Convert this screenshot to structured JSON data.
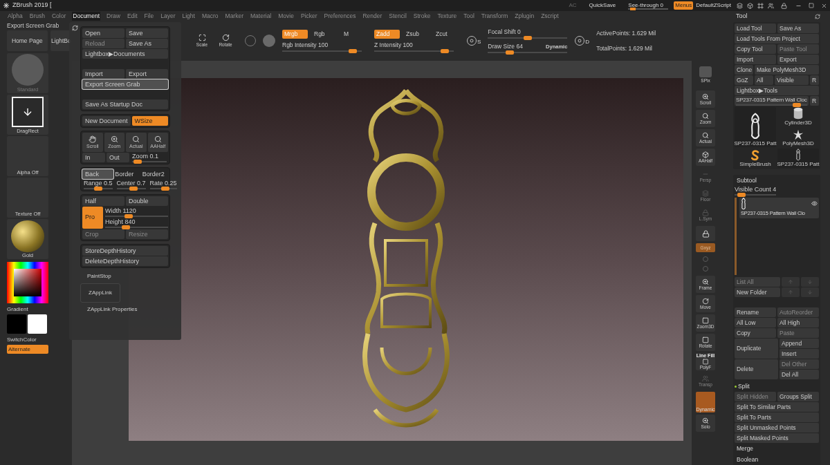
{
  "title_bar": {
    "title": "ZBrush 2019 [",
    "ac": "AC",
    "quicksave": "QuickSave",
    "see_through": {
      "label": "See-through",
      "value": "0",
      "level": 0.05
    },
    "menus": {
      "label": "Menus",
      "on": true
    },
    "script": "DefaultZScript"
  },
  "menu_bar": [
    {
      "label": "Alpha",
      "selected": false
    },
    {
      "label": "Brush",
      "selected": false
    },
    {
      "label": "Color",
      "selected": false
    },
    {
      "label": "Document",
      "selected": true
    },
    {
      "label": "Draw",
      "selected": false
    },
    {
      "label": "Edit",
      "selected": false
    },
    {
      "label": "File",
      "selected": false
    },
    {
      "label": "Layer",
      "selected": false
    },
    {
      "label": "Light",
      "selected": false
    },
    {
      "label": "Macro",
      "selected": false
    },
    {
      "label": "Marker",
      "selected": false
    },
    {
      "label": "Material",
      "selected": false
    },
    {
      "label": "Movie",
      "selected": false
    },
    {
      "label": "Picker",
      "selected": false
    },
    {
      "label": "Preferences",
      "selected": false
    },
    {
      "label": "Render",
      "selected": false
    },
    {
      "label": "Stencil",
      "selected": false
    },
    {
      "label": "Stroke",
      "selected": false
    },
    {
      "label": "Texture",
      "selected": false
    },
    {
      "label": "Tool",
      "selected": false
    },
    {
      "label": "Transform",
      "selected": false
    },
    {
      "label": "Zplugin",
      "selected": false
    },
    {
      "label": "Zscript",
      "selected": false
    }
  ],
  "left_shelf": {
    "hint": "Export Screen Grab",
    "buttons": [
      {
        "label": "Home Page"
      },
      {
        "label": "LightBo"
      }
    ],
    "slots": [
      {
        "kind": "brush",
        "label": "Standard"
      },
      {
        "kind": "stroke",
        "label": "DragRect"
      },
      {
        "kind": "empty",
        "label": "Alpha Off"
      },
      {
        "kind": "empty",
        "label": "Texture Off"
      },
      {
        "kind": "material",
        "label": "Gold"
      }
    ],
    "gradient": "Gradient",
    "switch_color": "SwitchColor",
    "alternate": {
      "label": "Alternate",
      "on": true
    }
  },
  "toolbar": {
    "transform": [
      {
        "label": "Scale"
      },
      {
        "label": "Rotate"
      }
    ],
    "rgb": {
      "modes": [
        {
          "label": "Mrgb",
          "on": true
        },
        {
          "label": "Rgb",
          "on": false
        },
        {
          "label": "M",
          "on": false
        }
      ],
      "slider": {
        "label": "Rgb Intensity",
        "value": "100",
        "level": 0.93
      }
    },
    "z": {
      "modes": [
        {
          "label": "Zadd",
          "on": true
        },
        {
          "label": "Zsub",
          "on": false
        },
        {
          "label": "Zcut",
          "on": false
        }
      ],
      "slider": {
        "label": "Z Intensity",
        "value": "100",
        "level": 0.93
      }
    },
    "s_label": "S",
    "focal": {
      "label": "Focal Shift",
      "value": "0",
      "level": 0.5
    },
    "draw_size": {
      "label": "Draw Size",
      "value": "64",
      "level": 0.25
    },
    "dynamic": "Dynamic",
    "d_label": "D",
    "points": [
      "ActivePoints: 1.629 Mil",
      "TotalPoints: 1.629 Mil"
    ]
  },
  "document_menu": {
    "panels": [
      {
        "sections": [
          [
            {
              "kind": "row",
              "items": [
                {
                  "kind": "button",
                  "label": "Open",
                  "disabled": false
                },
                {
                  "kind": "button",
                  "label": "Save",
                  "disabled": false
                }
              ]
            },
            {
              "kind": "row",
              "items": [
                {
                  "kind": "button",
                  "label": "Reload",
                  "disabled": true
                },
                {
                  "kind": "button",
                  "label": "Save As",
                  "disabled": false
                }
              ]
            },
            {
              "kind": "row",
              "items": [
                {
                  "kind": "button",
                  "label": "Lightbox▶Documents",
                  "disabled": false
                }
              ]
            }
          ],
          [
            {
              "kind": "row",
              "items": [
                {
                  "kind": "button",
                  "label": "Import",
                  "disabled": false
                },
                {
                  "kind": "button",
                  "label": "Export",
                  "disabled": false
                }
              ]
            },
            {
              "kind": "row",
              "items": [
                {
                  "kind": "button",
                  "label": "Export Screen Grab",
                  "disabled": false,
                  "highlighted": true
                }
              ]
            }
          ],
          [
            {
              "kind": "row",
              "items": [
                {
                  "kind": "button",
                  "label": "Save As Startup Doc",
                  "disabled": false
                }
              ]
            }
          ]
        ]
      },
      {
        "sections": [
          [
            {
              "kind": "row",
              "items": [
                {
                  "kind": "button",
                  "label": "New Document",
                  "disabled": false
                },
                {
                  "kind": "toggle",
                  "label": "WSize",
                  "on": true
                }
              ]
            }
          ]
        ]
      },
      {
        "sections": [
          [
            {
              "kind": "icons",
              "items": [
                {
                  "kind": "icon_button",
                  "label": "Scroll"
                },
                {
                  "kind": "icon_button",
                  "label": "Zoom"
                },
                {
                  "kind": "icon_button",
                  "label": "Actual"
                },
                {
                  "kind": "icon_button",
                  "label": "AAHalf"
                }
              ]
            },
            {
              "kind": "row",
              "items": [
                {
                  "kind": "button",
                  "label": "In",
                  "disabled": false
                },
                {
                  "kind": "button",
                  "label": "Out",
                  "disabled": false
                },
                {
                  "kind": "slider",
                  "label": "Zoom",
                  "value": "0.1",
                  "level": 0.05
                }
              ]
            }
          ]
        ]
      },
      {
        "sections": [
          [
            {
              "kind": "row",
              "items": [
                {
                  "kind": "button",
                  "label": "Back",
                  "disabled": false,
                  "highlighted": true
                },
                {
                  "kind": "label",
                  "label": "Border"
                },
                {
                  "kind": "label",
                  "label": "Border2"
                }
              ]
            },
            {
              "kind": "row",
              "items": [
                {
                  "kind": "slider",
                  "label": "Range",
                  "value": "0.5",
                  "level": 0.5
                },
                {
                  "kind": "slider",
                  "label": "Center",
                  "value": "0.7",
                  "level": 0.6
                },
                {
                  "kind": "slider",
                  "label": "Rate",
                  "value": "0.25",
                  "level": 0.6
                }
              ]
            }
          ]
        ]
      },
      {
        "sections": [
          [
            {
              "kind": "row",
              "items": [
                {
                  "kind": "button",
                  "label": "Half",
                  "disabled": false
                },
                {
                  "kind": "button",
                  "label": "Double",
                  "disabled": false
                }
              ]
            },
            {
              "kind": "stack",
              "items": [
                {
                  "kind": "toggle",
                  "label": "Pro",
                  "on": true
                },
                {
                  "kind": "slider",
                  "label": "Width",
                  "value": "1120",
                  "level": 0.35
                },
                {
                  "kind": "slider",
                  "label": "Height",
                  "value": "840",
                  "level": 0.3
                }
              ]
            },
            {
              "kind": "row",
              "items": [
                {
                  "kind": "button",
                  "label": "Crop",
                  "disabled": true
                },
                {
                  "kind": "button",
                  "label": "Resize",
                  "disabled": true
                }
              ]
            }
          ]
        ]
      },
      {
        "sections": [
          [
            {
              "kind": "row",
              "items": [
                {
                  "kind": "button",
                  "label": "StoreDepthHistory",
                  "disabled": false
                }
              ]
            },
            {
              "kind": "row",
              "items": [
                {
                  "kind": "button",
                  "label": "DeleteDepthHistory",
                  "disabled": false
                }
              ]
            }
          ]
        ]
      }
    ],
    "paint_stop": "PaintStop",
    "zapplink": "ZAppLink",
    "zapplink_properties": "ZAppLink Properties"
  },
  "right_shelf": [
    {
      "kind": "spix",
      "label": "SPix",
      "disabled": false
    },
    {
      "kind": "icon",
      "label": "Scroll",
      "disabled": false
    },
    {
      "kind": "icon",
      "label": "Zoom",
      "disabled": false
    },
    {
      "kind": "icon",
      "label": "Actual",
      "disabled": false
    },
    {
      "kind": "icon",
      "label": "AAHalf",
      "disabled": false
    },
    {
      "kind": "icon",
      "label": "Persp",
      "disabled": true
    },
    {
      "kind": "icon",
      "label": "Floor",
      "disabled": true
    },
    {
      "kind": "icon",
      "label": "L.Sym",
      "disabled": true
    },
    {
      "kind": "lock",
      "disabled": false
    },
    {
      "kind": "toggle",
      "label": "Gxyz",
      "on": true
    },
    {
      "kind": "axes",
      "disabled": true
    },
    {
      "kind": "icon",
      "label": "Frame",
      "disabled": false
    },
    {
      "kind": "icon",
      "label": "Move",
      "disabled": false
    },
    {
      "kind": "icon",
      "label": "Zoom3D",
      "disabled": false
    },
    {
      "kind": "icon",
      "label": "Rotate",
      "disabled": false
    },
    {
      "kind": "polyf",
      "top": "Line Fill",
      "label": "PolyF",
      "disabled": false
    },
    {
      "kind": "icon",
      "label": "Transp",
      "disabled": true
    },
    {
      "kind": "dynamic",
      "label": "Dynamic",
      "on": true
    },
    {
      "kind": "icon",
      "label": "Solo",
      "disabled": false
    }
  ],
  "tool_panel": {
    "title": "Tool",
    "rows": [
      [
        {
          "kind": "button",
          "label": "Load Tool",
          "disabled": false
        },
        {
          "kind": "button",
          "label": "Save As",
          "disabled": false
        }
      ],
      [
        {
          "kind": "button",
          "label": "Load Tools From Project",
          "disabled": false
        }
      ],
      [
        {
          "kind": "button",
          "label": "Copy Tool",
          "disabled": false
        },
        {
          "kind": "button",
          "label": "Paste Tool",
          "disabled": true
        }
      ],
      [
        {
          "kind": "button",
          "label": "Import",
          "disabled": false
        },
        {
          "kind": "button",
          "label": "Export",
          "disabled": false
        }
      ],
      [
        {
          "kind": "small",
          "label": "Clone",
          "disabled": false
        },
        {
          "kind": "button",
          "label": "Make PolyMesh3D",
          "disabled": false
        }
      ],
      [
        {
          "kind": "small",
          "label": "GoZ",
          "disabled": false
        },
        {
          "kind": "small",
          "label": "All",
          "disabled": false
        },
        {
          "kind": "button",
          "label": "Visible",
          "disabled": false
        },
        {
          "kind": "tiny",
          "label": "R",
          "disabled": false
        }
      ],
      [
        {
          "kind": "button",
          "label": "Lightbox▶Tools",
          "disabled": false
        }
      ]
    ],
    "current_tool": {
      "slider": {
        "label": "SP237-0315 Pattern Wall Cloc",
        "level": 0.9
      },
      "reset": {
        "label": "R",
        "disabled": false
      }
    },
    "thumbnails": [
      {
        "kind": "cylinder",
        "label": "Cylinder3D"
      },
      {
        "kind": "clock_large",
        "label": "SP237-0315 Patt"
      },
      {
        "kind": "star",
        "label": "PolyMesh3D"
      },
      {
        "kind": "brush",
        "label": "SimpleBrush"
      },
      {
        "kind": "clock",
        "label": "SP237-0315 Patt"
      }
    ],
    "subtool": {
      "title": "Subtool",
      "slider": {
        "label": "Visible Count",
        "value": "4",
        "level": 0.08
      },
      "item": {
        "label": "SP237-0315 Pattern Wall Clo",
        "visible": true
      },
      "rows": [
        [
          {
            "kind": "button",
            "label": "List All",
            "disabled": true
          },
          {
            "kind": "arrow",
            "disabled": true
          },
          {
            "kind": "arrow",
            "disabled": true
          }
        ],
        [
          {
            "kind": "button",
            "label": "New Folder",
            "disabled": false
          },
          {
            "kind": "arrow",
            "disabled": true
          },
          {
            "kind": "arrow",
            "disabled": true
          }
        ]
      ],
      "rows2": [
        [
          {
            "kind": "button",
            "label": "Rename",
            "disabled": false
          },
          {
            "kind": "button",
            "label": "AutoReorder",
            "disabled": true
          }
        ],
        [
          {
            "kind": "button",
            "label": "All Low",
            "disabled": false
          },
          {
            "kind": "button",
            "label": "All High",
            "disabled": false
          }
        ],
        [
          {
            "kind": "button",
            "label": "Copy",
            "disabled": false
          },
          {
            "kind": "button",
            "label": "Paste",
            "disabled": true
          }
        ]
      ],
      "pairs": [
        {
          "main": {
            "label": "Duplicate",
            "disabled": false
          },
          "side": [
            {
              "label": "Append",
              "disabled": false
            },
            {
              "label": "Insert",
              "disabled": false
            }
          ]
        },
        {
          "main": {
            "label": "Delete",
            "disabled": false
          },
          "side": [
            {
              "label": "Del Other",
              "disabled": true
            },
            {
              "label": "Del All",
              "disabled": false
            }
          ]
        }
      ]
    },
    "split": {
      "title": "Split",
      "rows": [
        [
          {
            "kind": "button",
            "label": "Split Hidden",
            "disabled": true
          },
          {
            "kind": "button",
            "label": "Groups Split",
            "disabled": false
          }
        ],
        [
          {
            "kind": "button",
            "label": "Split To Similar Parts",
            "disabled": false
          }
        ],
        [
          {
            "kind": "button",
            "label": "Split To Parts",
            "disabled": false
          }
        ],
        [
          {
            "kind": "button",
            "label": "Split Unmasked Points",
            "disabled": false
          }
        ],
        [
          {
            "kind": "button",
            "label": "Split Masked Points",
            "disabled": false
          }
        ]
      ]
    },
    "sections": [
      "Merge",
      "Boolean"
    ]
  }
}
